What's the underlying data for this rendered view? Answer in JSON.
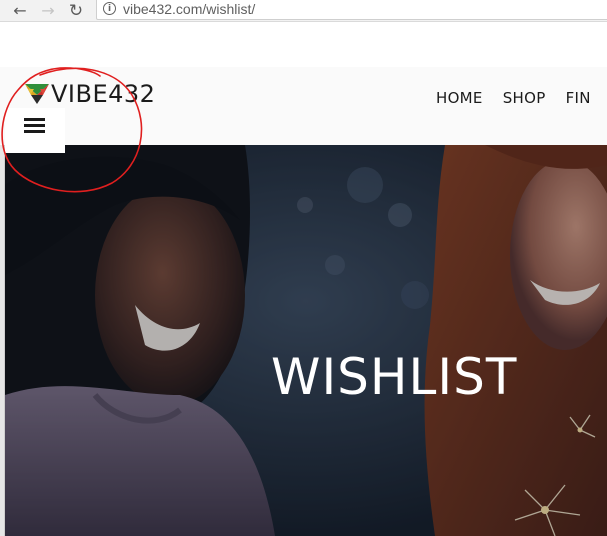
{
  "browser": {
    "url": "vibe432.com/wishlist/",
    "back_glyph": "←",
    "forward_glyph": "→",
    "reload_glyph": "↻",
    "info_glyph": "i"
  },
  "site": {
    "logo_text": "VIBE432",
    "nav": [
      {
        "label": "HOME"
      },
      {
        "label": "SHOP"
      },
      {
        "label": "FIN"
      }
    ]
  },
  "hero": {
    "title": "WISHLIST"
  },
  "colors": {
    "annotation": "#e01f1f",
    "hero_overlay": "#17202e",
    "text_dark": "#1b1b1b"
  },
  "icons": {
    "back": "back-arrow-icon",
    "forward": "forward-arrow-icon",
    "reload": "reload-icon",
    "info": "info-icon",
    "menu": "hamburger-menu-icon",
    "logo": "logo-mark-icon"
  }
}
